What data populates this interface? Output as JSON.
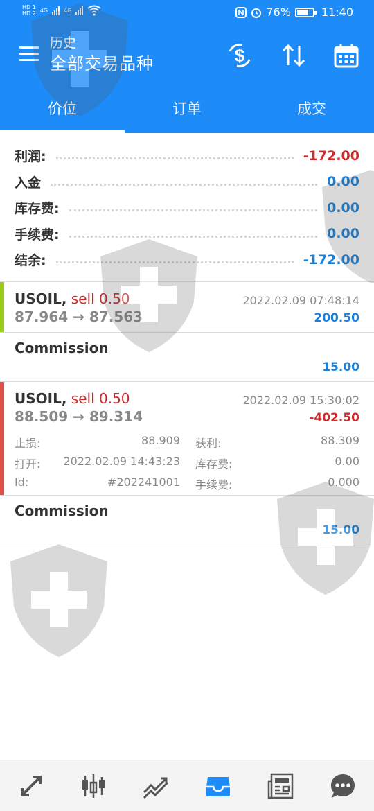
{
  "status_bar": {
    "sim1": "HD 1",
    "sim2": "HD 2",
    "net1": "4G",
    "net2": "4G",
    "battery": "76%",
    "time": "11:40"
  },
  "header": {
    "title": "历史",
    "subtitle": "全部交易品种",
    "icons": [
      "menu-icon",
      "dollar-exchange-icon",
      "sort-icon",
      "calendar-icon"
    ]
  },
  "tabs": [
    {
      "label": "价位",
      "active": true
    },
    {
      "label": "订单",
      "active": false
    },
    {
      "label": "成交",
      "active": false
    }
  ],
  "summary": [
    {
      "label": "利润:",
      "value": "-172.00",
      "negative": true
    },
    {
      "label": "入金",
      "value": "0.00",
      "negative": false
    },
    {
      "label": "库存费:",
      "value": "0.00",
      "negative": false
    },
    {
      "label": "手续费:",
      "value": "0.00",
      "negative": false
    },
    {
      "label": "结余:",
      "value": "-172.00",
      "negative": false
    }
  ],
  "deals": [
    {
      "symbol": "USOIL,",
      "side": "sell 0.50",
      "prices": "87.964 → 87.563",
      "time": "2022.02.09 07:48:14",
      "profit": "200.50",
      "bar_color": "#9ccc1a"
    },
    {
      "symbol": "USOIL,",
      "side": "sell 0.50",
      "prices": "88.509 → 89.314",
      "time": "2022.02.09 15:30:02",
      "profit": "-402.50",
      "bar_color": "#e0504a",
      "details": {
        "sl_label": "止损:",
        "sl_value": "88.909",
        "tp_label": "获利:",
        "tp_value": "88.309",
        "open_label": "打开:",
        "open_value": "2022.02.09 14:43:23",
        "swap_label": "库存费:",
        "swap_value": "0.00",
        "id_label": "Id:",
        "id_value": "#202241001",
        "fee_label": "手续费:",
        "fee_value": "0.000"
      }
    }
  ],
  "commissions": [
    {
      "label": "Commission",
      "value": "15.00"
    },
    {
      "label": "Commission",
      "value": "15.00"
    }
  ],
  "bottom_nav": [
    {
      "name": "quotes-icon"
    },
    {
      "name": "chart-candles-icon"
    },
    {
      "name": "trade-icon"
    },
    {
      "name": "history-icon",
      "active": true
    },
    {
      "name": "news-icon"
    },
    {
      "name": "chat-icon"
    }
  ],
  "colors": {
    "primary": "#1d8cf8",
    "positive": "#1a7fd6",
    "negative": "#cc2b2b",
    "nav_active": "#1d8cf8",
    "nav_inactive": "#555555"
  }
}
